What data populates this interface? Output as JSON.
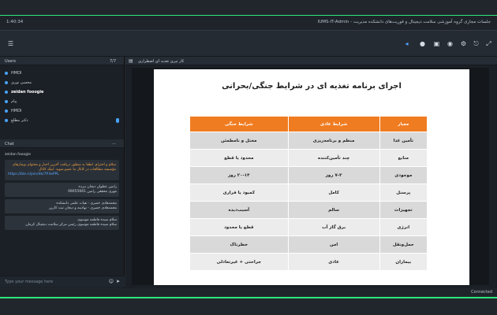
{
  "titlebar": {
    "title": "جلسات مجازی گروه آموزشی سلامت دیجیتال و فوریت‌های دانشکده مدیریت - IUMS-IT-Admin",
    "session": "1:40:34"
  },
  "toolbar": {
    "buttons": [
      "menu-icon",
      "share-icon",
      "mic-icon",
      "camera-icon",
      "record-icon",
      "settings-icon",
      "exit-icon",
      "fullscreen-icon"
    ]
  },
  "users": {
    "header": "Users",
    "count": "7/7",
    "items": [
      {
        "name": "HMDI"
      },
      {
        "name": "محسن نوری"
      },
      {
        "name": "zeidan fooogie"
      },
      {
        "name": "پیام"
      },
      {
        "name": "HMDI"
      },
      {
        "name": "دکتر مطلع"
      }
    ]
  },
  "chat": {
    "header": "Chat",
    "sender1": "zeidan fooogie",
    "message1": "سلام و احترام. لطفا به منظور دریافت آخرین اخبار و محتوای وبینارهای مؤسسه مطالعات در کانال ما عضو شوید. لینک کانال",
    "link1": "https://ble.ir/join/dk/7P3ePPL",
    "block1_line1": "رامین عطوان دیجان نبرده",
    "block1_line2": "مهری محققی رامین 09055661",
    "block2_line1": "محمدهادی خضری - هیات علمی دانشکده",
    "block2_line2": "محمدهادی خضری - نهادینه و دیجان ثبت کارین",
    "block3_line1": "سلام سیده فاطمه موسوی",
    "block3_line2": "سلام سیده فاطمه موسوی رئیس مرکز سلامت دیجیتال کرمان",
    "input_placeholder": "Type your message here"
  },
  "content": {
    "header": "کار تیری تغذیه ای اضطراری",
    "slide_title": "اجرای برنامه تغذیه ای در شرایط جنگی/بحرانی",
    "table_headers": [
      "معیار",
      "شرایط عادی",
      "شرایط جنگی"
    ],
    "table_rows": [
      [
        "تأمین غذا",
        "منظم و برنامه‌ریزی",
        "مختل و نامطمئن"
      ],
      [
        "منابع",
        "چند تأمین‌کننده",
        "محدود یا قطع"
      ],
      [
        "موجودی",
        "۷-۳ روز",
        "۲۰-۱۴ روز"
      ],
      [
        "پرسنل",
        "کامل",
        "کمبود یا فراری"
      ],
      [
        "تجهیزات",
        "سالم",
        "آسیب‌دیده"
      ],
      [
        "انرژی",
        "برق گاز آب",
        "قطع یا محدود"
      ],
      [
        "حمل‌ونقل",
        "امن",
        "خطرناک"
      ],
      [
        "بیماران",
        "عادی",
        "جراحتی + غیرتعادلی"
      ]
    ]
  },
  "status": {
    "right": "Connected",
    "left": ""
  }
}
